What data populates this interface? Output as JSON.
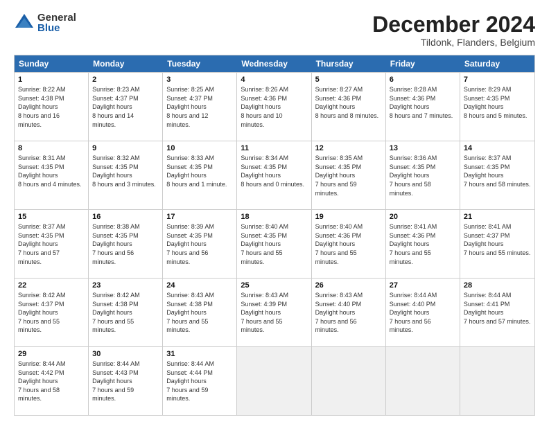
{
  "logo": {
    "general": "General",
    "blue": "Blue"
  },
  "title": "December 2024",
  "location": "Tildonk, Flanders, Belgium",
  "days": [
    "Sunday",
    "Monday",
    "Tuesday",
    "Wednesday",
    "Thursday",
    "Friday",
    "Saturday"
  ],
  "weeks": [
    [
      {
        "day": "1",
        "rise": "8:22 AM",
        "set": "4:38 PM",
        "daylight": "8 hours and 16 minutes."
      },
      {
        "day": "2",
        "rise": "8:23 AM",
        "set": "4:37 PM",
        "daylight": "8 hours and 14 minutes."
      },
      {
        "day": "3",
        "rise": "8:25 AM",
        "set": "4:37 PM",
        "daylight": "8 hours and 12 minutes."
      },
      {
        "day": "4",
        "rise": "8:26 AM",
        "set": "4:36 PM",
        "daylight": "8 hours and 10 minutes."
      },
      {
        "day": "5",
        "rise": "8:27 AM",
        "set": "4:36 PM",
        "daylight": "8 hours and 8 minutes."
      },
      {
        "day": "6",
        "rise": "8:28 AM",
        "set": "4:36 PM",
        "daylight": "8 hours and 7 minutes."
      },
      {
        "day": "7",
        "rise": "8:29 AM",
        "set": "4:35 PM",
        "daylight": "8 hours and 5 minutes."
      }
    ],
    [
      {
        "day": "8",
        "rise": "8:31 AM",
        "set": "4:35 PM",
        "daylight": "8 hours and 4 minutes."
      },
      {
        "day": "9",
        "rise": "8:32 AM",
        "set": "4:35 PM",
        "daylight": "8 hours and 3 minutes."
      },
      {
        "day": "10",
        "rise": "8:33 AM",
        "set": "4:35 PM",
        "daylight": "8 hours and 1 minute."
      },
      {
        "day": "11",
        "rise": "8:34 AM",
        "set": "4:35 PM",
        "daylight": "8 hours and 0 minutes."
      },
      {
        "day": "12",
        "rise": "8:35 AM",
        "set": "4:35 PM",
        "daylight": "7 hours and 59 minutes."
      },
      {
        "day": "13",
        "rise": "8:36 AM",
        "set": "4:35 PM",
        "daylight": "7 hours and 58 minutes."
      },
      {
        "day": "14",
        "rise": "8:37 AM",
        "set": "4:35 PM",
        "daylight": "7 hours and 58 minutes."
      }
    ],
    [
      {
        "day": "15",
        "rise": "8:37 AM",
        "set": "4:35 PM",
        "daylight": "7 hours and 57 minutes."
      },
      {
        "day": "16",
        "rise": "8:38 AM",
        "set": "4:35 PM",
        "daylight": "7 hours and 56 minutes."
      },
      {
        "day": "17",
        "rise": "8:39 AM",
        "set": "4:35 PM",
        "daylight": "7 hours and 56 minutes."
      },
      {
        "day": "18",
        "rise": "8:40 AM",
        "set": "4:35 PM",
        "daylight": "7 hours and 55 minutes."
      },
      {
        "day": "19",
        "rise": "8:40 AM",
        "set": "4:36 PM",
        "daylight": "7 hours and 55 minutes."
      },
      {
        "day": "20",
        "rise": "8:41 AM",
        "set": "4:36 PM",
        "daylight": "7 hours and 55 minutes."
      },
      {
        "day": "21",
        "rise": "8:41 AM",
        "set": "4:37 PM",
        "daylight": "7 hours and 55 minutes."
      }
    ],
    [
      {
        "day": "22",
        "rise": "8:42 AM",
        "set": "4:37 PM",
        "daylight": "7 hours and 55 minutes."
      },
      {
        "day": "23",
        "rise": "8:42 AM",
        "set": "4:38 PM",
        "daylight": "7 hours and 55 minutes."
      },
      {
        "day": "24",
        "rise": "8:43 AM",
        "set": "4:38 PM",
        "daylight": "7 hours and 55 minutes."
      },
      {
        "day": "25",
        "rise": "8:43 AM",
        "set": "4:39 PM",
        "daylight": "7 hours and 55 minutes."
      },
      {
        "day": "26",
        "rise": "8:43 AM",
        "set": "4:40 PM",
        "daylight": "7 hours and 56 minutes."
      },
      {
        "day": "27",
        "rise": "8:44 AM",
        "set": "4:40 PM",
        "daylight": "7 hours and 56 minutes."
      },
      {
        "day": "28",
        "rise": "8:44 AM",
        "set": "4:41 PM",
        "daylight": "7 hours and 57 minutes."
      }
    ],
    [
      {
        "day": "29",
        "rise": "8:44 AM",
        "set": "4:42 PM",
        "daylight": "7 hours and 58 minutes."
      },
      {
        "day": "30",
        "rise": "8:44 AM",
        "set": "4:43 PM",
        "daylight": "7 hours and 59 minutes."
      },
      {
        "day": "31",
        "rise": "8:44 AM",
        "set": "4:44 PM",
        "daylight": "7 hours and 59 minutes."
      },
      null,
      null,
      null,
      null
    ]
  ]
}
